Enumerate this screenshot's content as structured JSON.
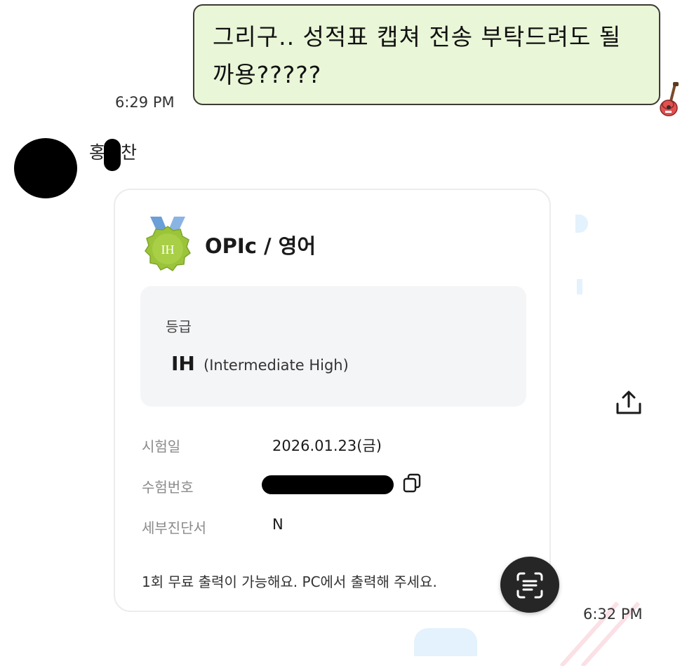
{
  "chat": {
    "outgoing": {
      "message": "그리구.. 성적표 캡쳐 전송 부탁드려도 될까용?????",
      "time": "6:29 PM"
    },
    "incoming": {
      "sender_name_first": "홍",
      "sender_name_last": "찬",
      "time": "6:32 PM"
    }
  },
  "card": {
    "title": "OPIc / 영어",
    "medal_text": "IH",
    "grade": {
      "label": "등급",
      "value": "IH",
      "description": "(Intermediate High)"
    },
    "rows": [
      {
        "label": "시험일",
        "value": "2026.01.23(금)"
      },
      {
        "label": "수험번호",
        "value": ""
      },
      {
        "label": "세부진단서",
        "value": "N"
      }
    ],
    "notice": "1회 무료 출력이 가능해요. PC에서 출력해 주세요."
  },
  "colors": {
    "bubble_bg": "#e9f6d7",
    "medal_green": "#9bc43a",
    "medal_ribbon": "#6a9fd8",
    "scan_button_bg": "#262626"
  },
  "icons": {
    "share": "share-icon",
    "copy": "copy-icon",
    "scan": "text-scan-icon",
    "sticker": "guitar-sticker-icon"
  }
}
